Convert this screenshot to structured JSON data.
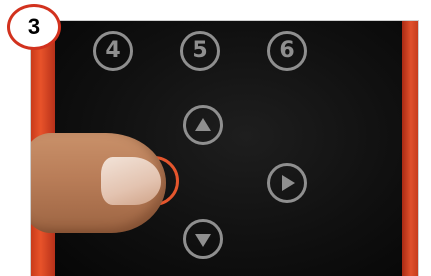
{
  "step": {
    "number": "3",
    "badge_color": "#d2321e"
  },
  "keypad": {
    "digit_keys": [
      "4",
      "5",
      "6"
    ],
    "arrow_keys": [
      "up-arrow-icon",
      "right-arrow-icon",
      "down-arrow-icon"
    ],
    "highlighted_key": "left-arrow-key",
    "highlight_color": "#e5562d"
  },
  "device": {
    "case_color": "#e8532a",
    "face_color": "#101010",
    "key_color": "#8f8f8f"
  }
}
